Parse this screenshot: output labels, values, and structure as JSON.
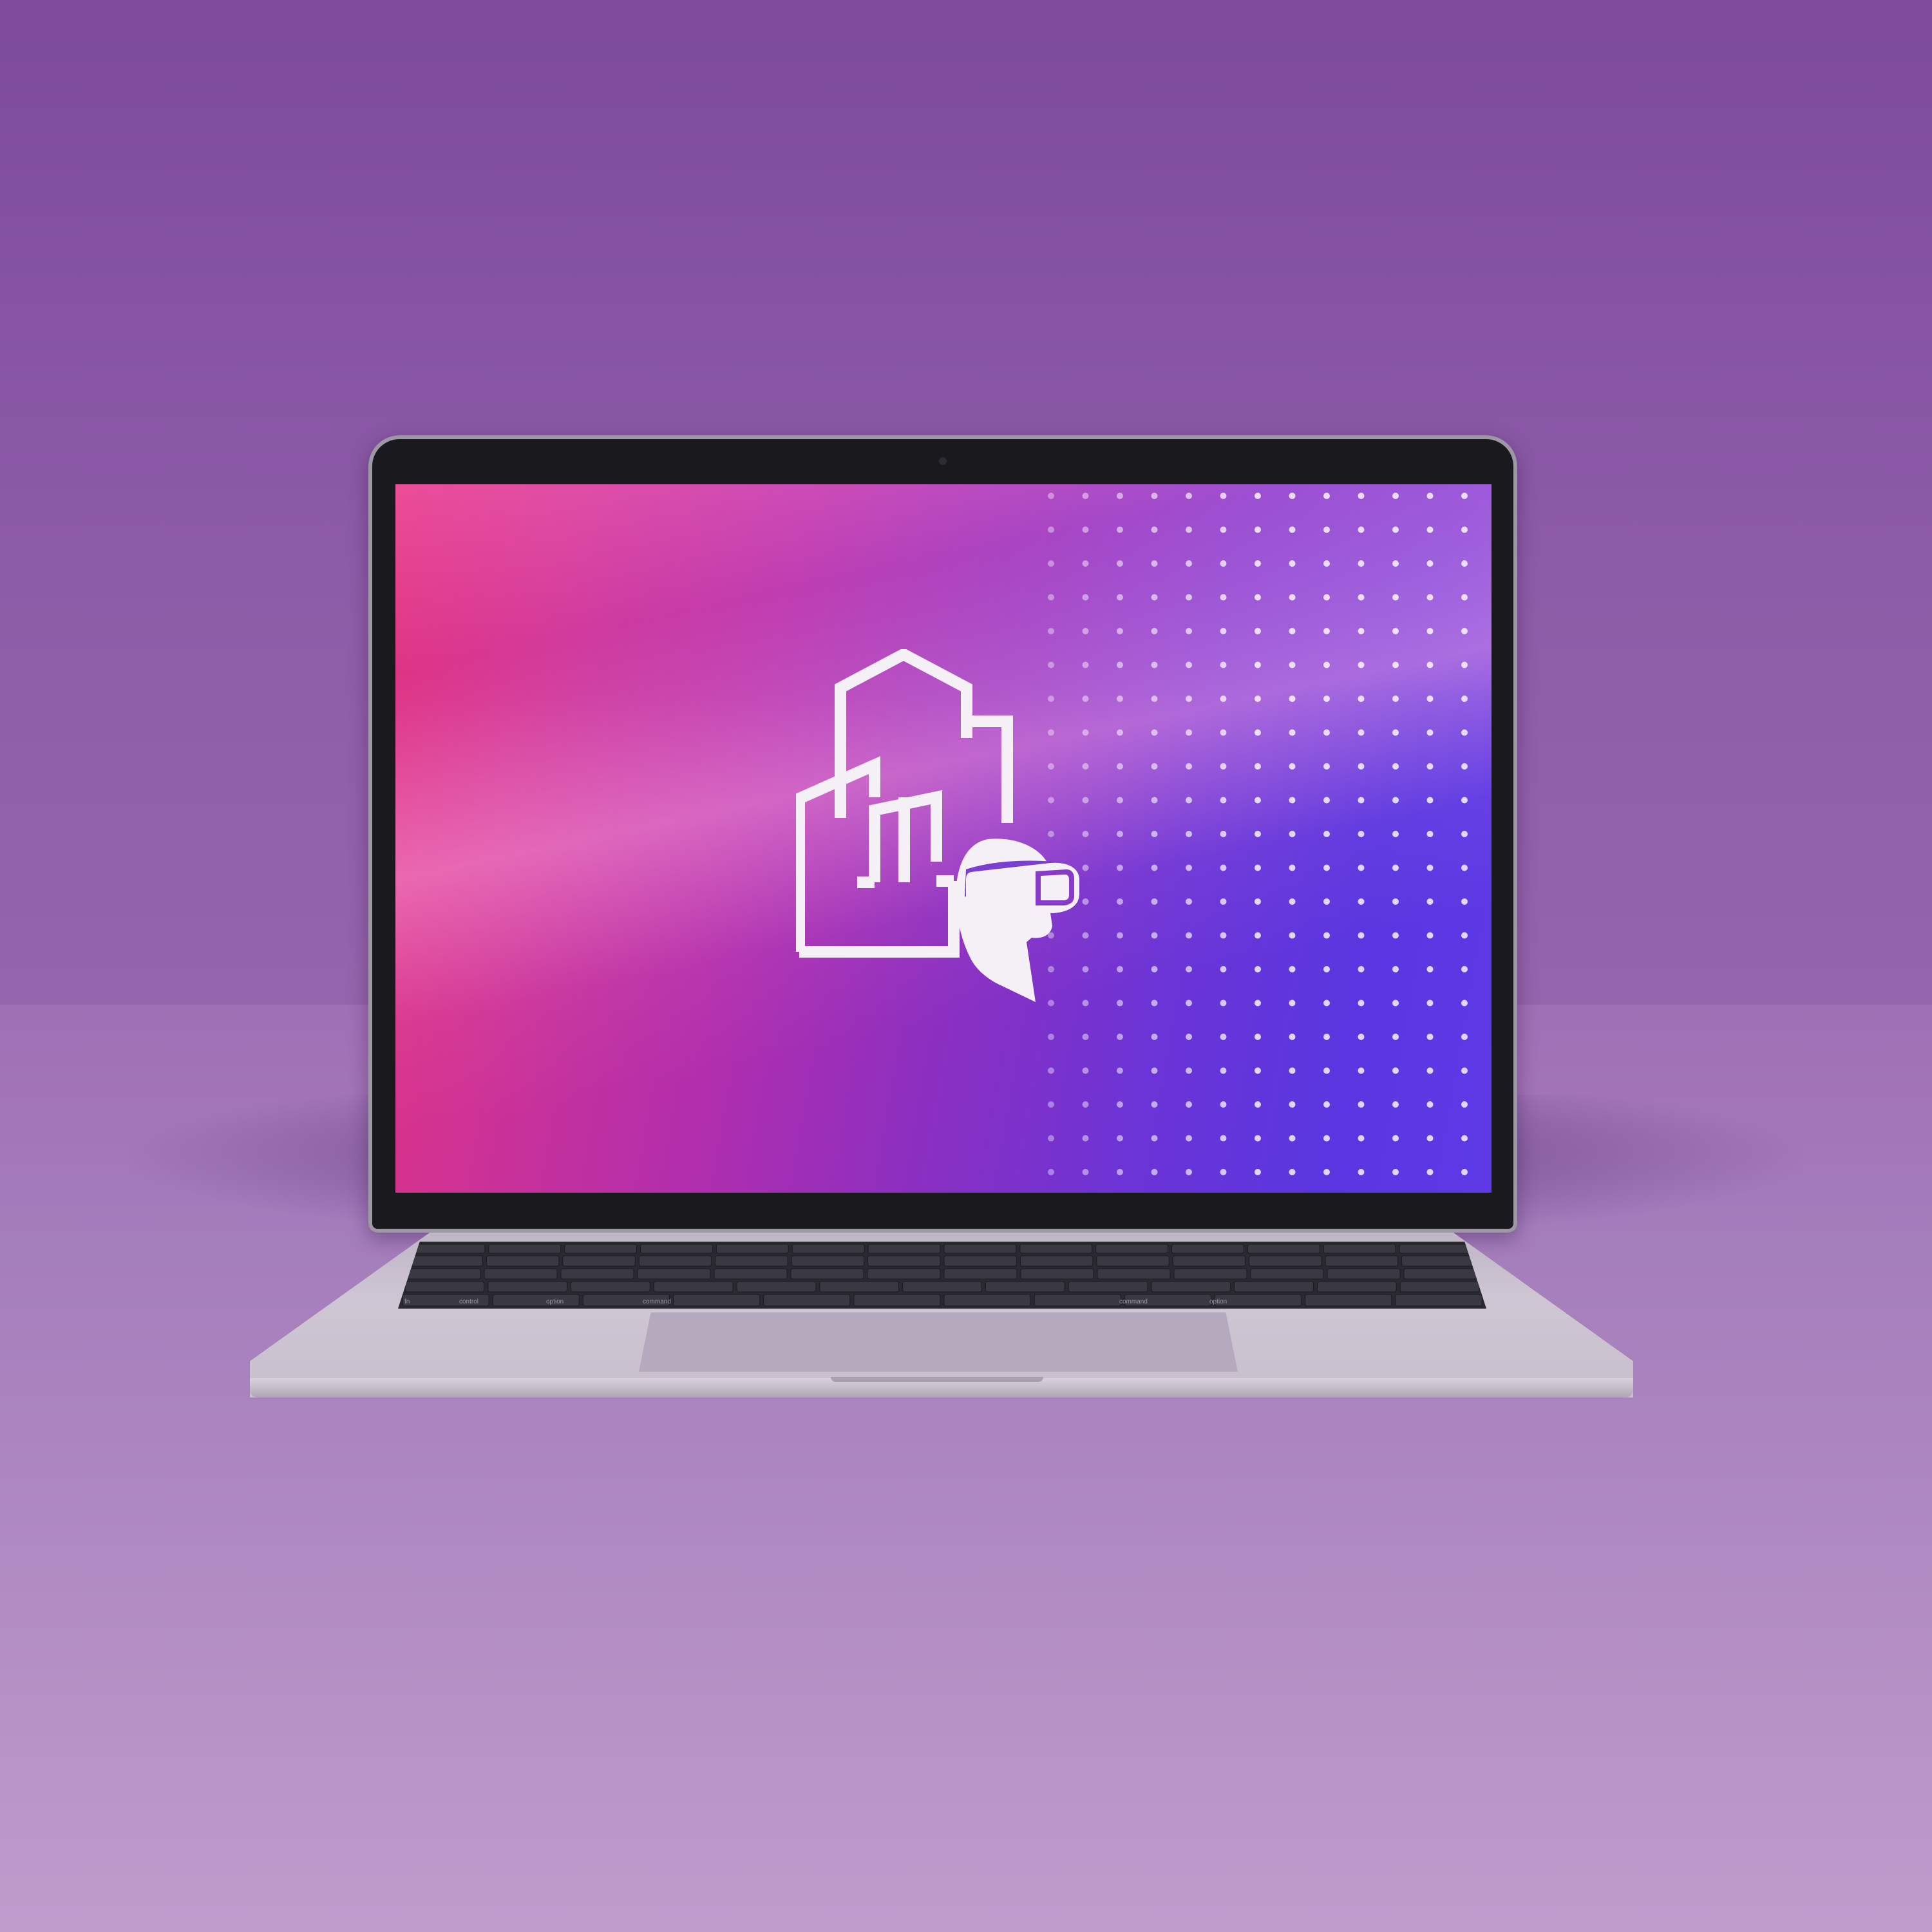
{
  "scene": {
    "description_color_bg": "#8d5ca8",
    "accent_pink": "#e0307e",
    "accent_violet": "#5a36e0"
  },
  "laptop": {
    "screen": {
      "logo_icon": "city-buildings-vr-headset-icon",
      "dot_grid_icon": "dot-grid-pattern"
    },
    "keyboard": {
      "labels": [
        "fn",
        "control",
        "option",
        "command",
        "command",
        "option"
      ]
    }
  }
}
